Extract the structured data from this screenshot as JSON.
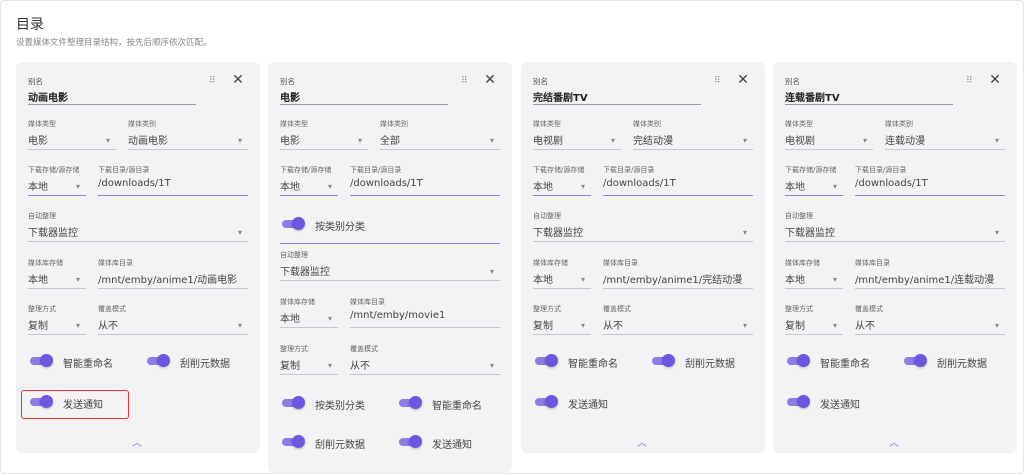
{
  "page": {
    "title": "目录",
    "subtitle": "设置媒体文件整理目录结构，按先后顺序依次匹配。"
  },
  "labels": {
    "alias": "别名",
    "media_type": "媒体类型",
    "media_category": "媒体类别",
    "download_storage": "下载存储/源存储",
    "download_dir": "下载目录/源目录",
    "auto_organize": "自动整理",
    "library_storage": "媒体库存储",
    "library_dir": "媒体库目录",
    "organize_method": "整理方式",
    "overwrite_mode": "覆盖模式",
    "by_category": "按类别分类",
    "smart_rename": "智能重命名",
    "scrape_metadata": "刮削元数据",
    "send_notification": "发送通知"
  },
  "icons": {
    "drag": "drag-handle-icon",
    "close": "close-icon",
    "caret": "caret-down-icon",
    "collapse": "chevron-up-icon"
  },
  "colors": {
    "accent": "#6d56e0",
    "highlight": "#e53935"
  },
  "cards": [
    {
      "alias": "动画电影",
      "media_type": "电影",
      "media_category": "动画电影",
      "download_storage": "本地",
      "download_dir": "/downloads/1T",
      "auto_organize": "下载器监控",
      "library_storage": "本地",
      "library_dir": "/mnt/emby/anime1/动画电影",
      "organize_method": "复制",
      "overwrite_mode": "从不",
      "by_category": null,
      "smart_rename": true,
      "scrape_metadata": true,
      "send_notification": true
    },
    {
      "alias": "电影",
      "media_type": "电影",
      "media_category": "全部",
      "download_storage": "本地",
      "download_dir": "/downloads/1T",
      "auto_organize": "下载器监控",
      "library_storage": "本地",
      "library_dir": "/mnt/emby/movie1",
      "organize_method": "复制",
      "overwrite_mode": "从不",
      "by_category": true,
      "smart_rename": true,
      "scrape_metadata": true,
      "send_notification": true
    },
    {
      "alias": "完结番剧TV",
      "media_type": "电视剧",
      "media_category": "完结动漫",
      "download_storage": "本地",
      "download_dir": "/downloads/1T",
      "auto_organize": "下载器监控",
      "library_storage": "本地",
      "library_dir": "/mnt/emby/anime1/完结动漫",
      "organize_method": "复制",
      "overwrite_mode": "从不",
      "by_category": null,
      "smart_rename": true,
      "scrape_metadata": true,
      "send_notification": true
    },
    {
      "alias": "连载番剧TV",
      "media_type": "电视剧",
      "media_category": "连载动漫",
      "download_storage": "本地",
      "download_dir": "/downloads/1T",
      "auto_organize": "下载器监控",
      "library_storage": "本地",
      "library_dir": "/mnt/emby/anime1/连载动漫",
      "organize_method": "复制",
      "overwrite_mode": "从不",
      "by_category": null,
      "smart_rename": true,
      "scrape_metadata": true,
      "send_notification": true
    }
  ]
}
